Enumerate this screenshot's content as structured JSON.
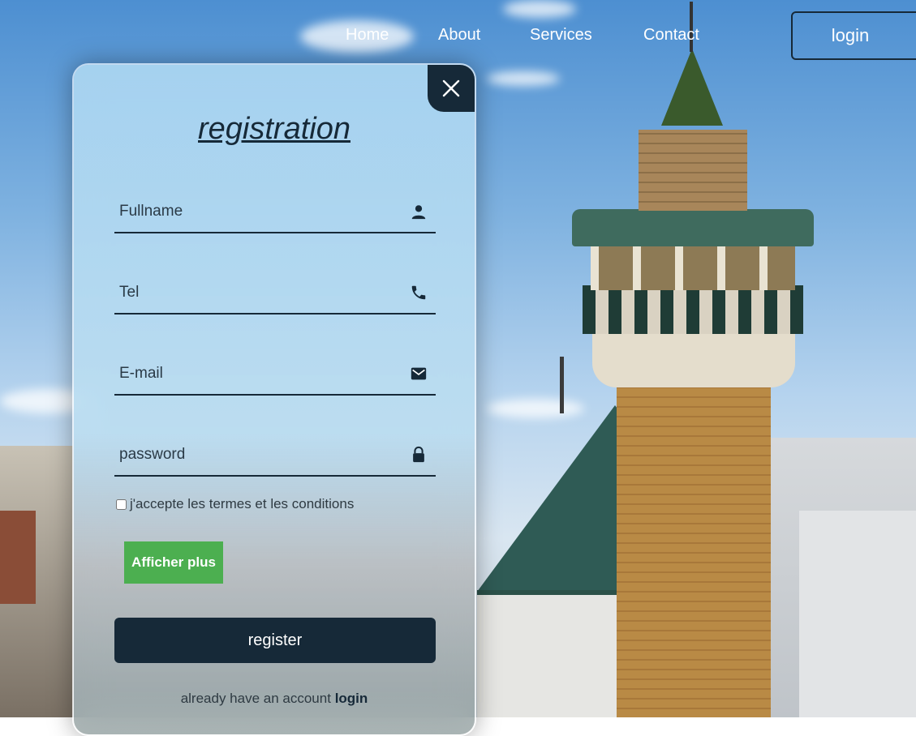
{
  "nav": {
    "items": [
      {
        "label": "Home"
      },
      {
        "label": "About"
      },
      {
        "label": "Services"
      },
      {
        "label": "Contact"
      }
    ],
    "login_label": "login"
  },
  "form": {
    "close_icon": "close-icon",
    "title": "registration",
    "fields": {
      "fullname": {
        "placeholder": "Fullname",
        "value": "",
        "icon": "person-icon"
      },
      "tel": {
        "placeholder": "Tel",
        "value": "",
        "icon": "phone-icon"
      },
      "email": {
        "placeholder": "E-mail",
        "value": "",
        "icon": "mail-icon"
      },
      "password": {
        "placeholder": "password",
        "value": "",
        "icon": "lock-icon"
      }
    },
    "terms_label": "j'accepte les termes et les conditions",
    "terms_checked": false,
    "more_button": "Afficher plus",
    "register_button": "register",
    "already_text": "already have an account",
    "login_link": "login"
  },
  "colors": {
    "primary": "#162938",
    "more_button": "#4caf50",
    "nav_text": "#ffffff"
  }
}
